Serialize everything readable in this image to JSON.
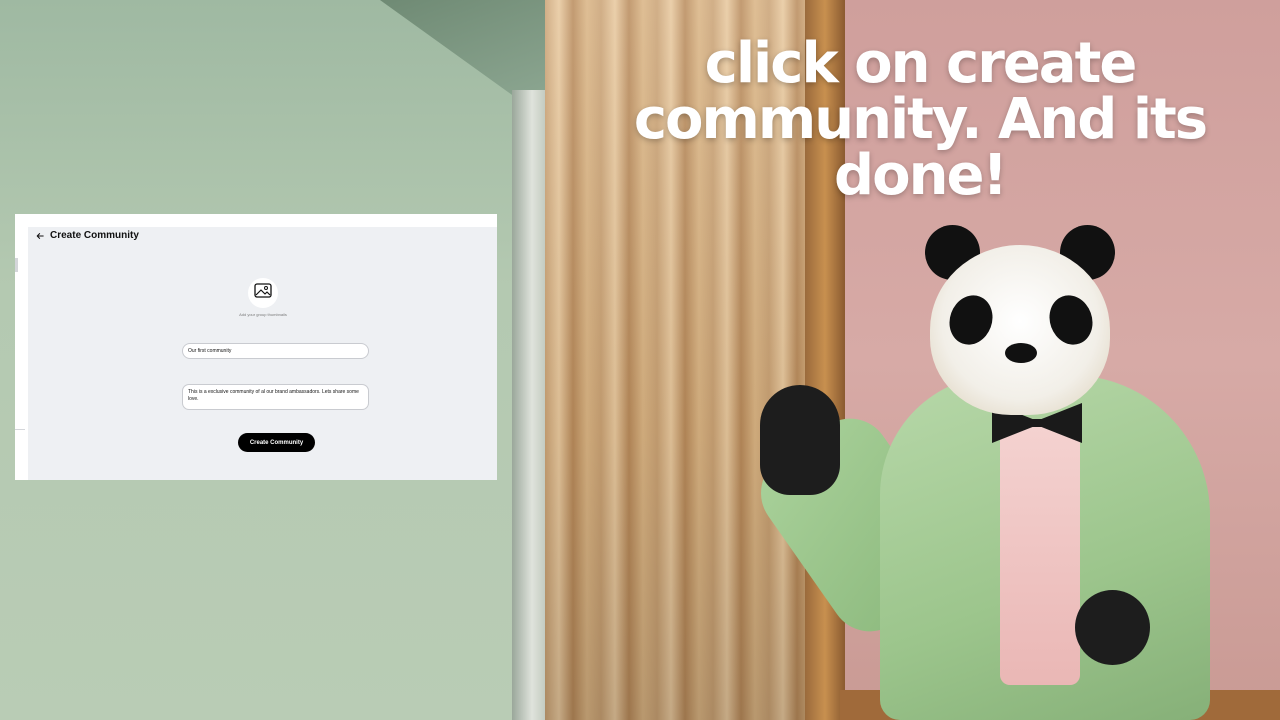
{
  "caption": {
    "text": "click on create community. And its done!"
  },
  "screenshot": {
    "title": "Create Community",
    "avatar_hint": "Add your group thumbnails",
    "name_value": "Our first community",
    "description_value": "This is a exclusive community of al our brand ambassadors. Lets share some love.",
    "submit_label": "Create Community"
  },
  "icons": {
    "back": "arrow-left-icon",
    "image": "image-icon"
  },
  "colors": {
    "caption": "#ffffff",
    "button_bg": "#000000",
    "card_bg": "#eef0f3"
  }
}
